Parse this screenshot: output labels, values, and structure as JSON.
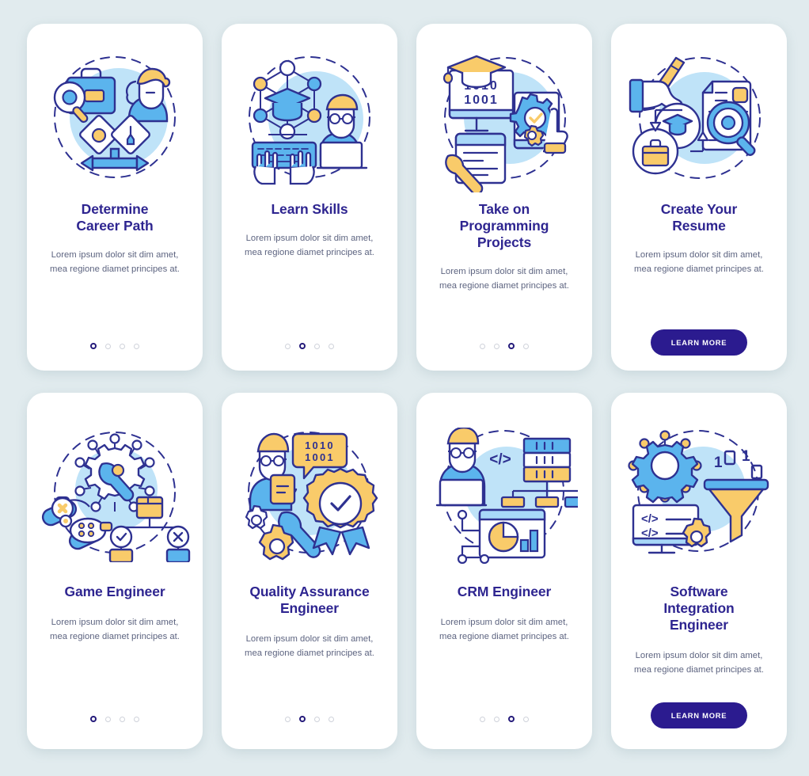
{
  "page": {
    "background_color": "#e1ebee",
    "title_color": "#2e2590",
    "body_color": "#5d6480",
    "button_color": "#2b1b8f",
    "accent_blue": "#5bb4ed",
    "accent_light_blue": "#bfe3f8",
    "accent_yellow": "#f9cb6a",
    "outline_navy": "#2e3191",
    "card_background": "#ffffff"
  },
  "screens": [
    {
      "id": "determine-career-path",
      "title": "Determine Career Path",
      "title_lines": [
        "Determine",
        "Career Path"
      ],
      "body": "Lorem ipsum dolor sit dim amet, mea regione diamet principes at.",
      "illustration": "career-path-illustration",
      "footer_type": "dots",
      "dots": {
        "count": 4,
        "active_index": 0
      }
    },
    {
      "id": "learn-skills",
      "title": "Learn Skills",
      "title_lines": [
        "Learn Skills"
      ],
      "body": "Lorem ipsum dolor sit dim amet, mea regione diamet principes at.",
      "illustration": "learn-skills-illustration",
      "footer_type": "dots",
      "dots": {
        "count": 4,
        "active_index": 1
      }
    },
    {
      "id": "take-on-programming-projects",
      "title": "Take on Programming Projects",
      "title_lines": [
        "Take on",
        "Programming",
        "Projects"
      ],
      "body": "Lorem ipsum dolor sit dim amet, mea regione diamet principes at.",
      "illustration": "programming-projects-illustration",
      "footer_type": "dots",
      "dots": {
        "count": 4,
        "active_index": 2
      }
    },
    {
      "id": "create-your-resume",
      "title": "Create Your Resume",
      "title_lines": [
        "Create Your",
        "Resume"
      ],
      "body": "Lorem ipsum dolor sit dim amet, mea regione diamet principes at.",
      "illustration": "create-resume-illustration",
      "footer_type": "button",
      "button_label": "LEARN MORE"
    },
    {
      "id": "game-engineer",
      "title": "Game Engineer",
      "title_lines": [
        "Game Engineer"
      ],
      "body": "Lorem ipsum dolor sit dim amet, mea regione diamet principes at.",
      "illustration": "game-engineer-illustration",
      "footer_type": "dots",
      "dots": {
        "count": 4,
        "active_index": 0
      }
    },
    {
      "id": "quality-assurance-engineer",
      "title": "Quality Assurance Engineer",
      "title_lines": [
        "Quality Assurance",
        "Engineer"
      ],
      "body": "Lorem ipsum dolor sit dim amet, mea regione diamet principes at.",
      "illustration": "quality-assurance-illustration",
      "footer_type": "dots",
      "dots": {
        "count": 4,
        "active_index": 1
      }
    },
    {
      "id": "crm-engineer",
      "title": "CRM Engineer",
      "title_lines": [
        "CRM Engineer"
      ],
      "body": "Lorem ipsum dolor sit dim amet, mea regione diamet principes at.",
      "illustration": "crm-engineer-illustration",
      "footer_type": "dots",
      "dots": {
        "count": 4,
        "active_index": 2
      }
    },
    {
      "id": "software-integration-engineer",
      "title": "Software Integration Engineer",
      "title_lines": [
        "Software",
        "Integration",
        "Engineer"
      ],
      "body": "Lorem ipsum dolor sit dim amet, mea regione diamet principes at.",
      "illustration": "software-integration-illustration",
      "footer_type": "button",
      "button_label": "LEARN MORE"
    }
  ],
  "illustration_text": {
    "binary_top": "1 0 1 0",
    "binary_bottom": "1 0 0 1",
    "code_tag": "</>",
    "binary_digits": [
      "1",
      "0",
      "1",
      "0"
    ]
  }
}
